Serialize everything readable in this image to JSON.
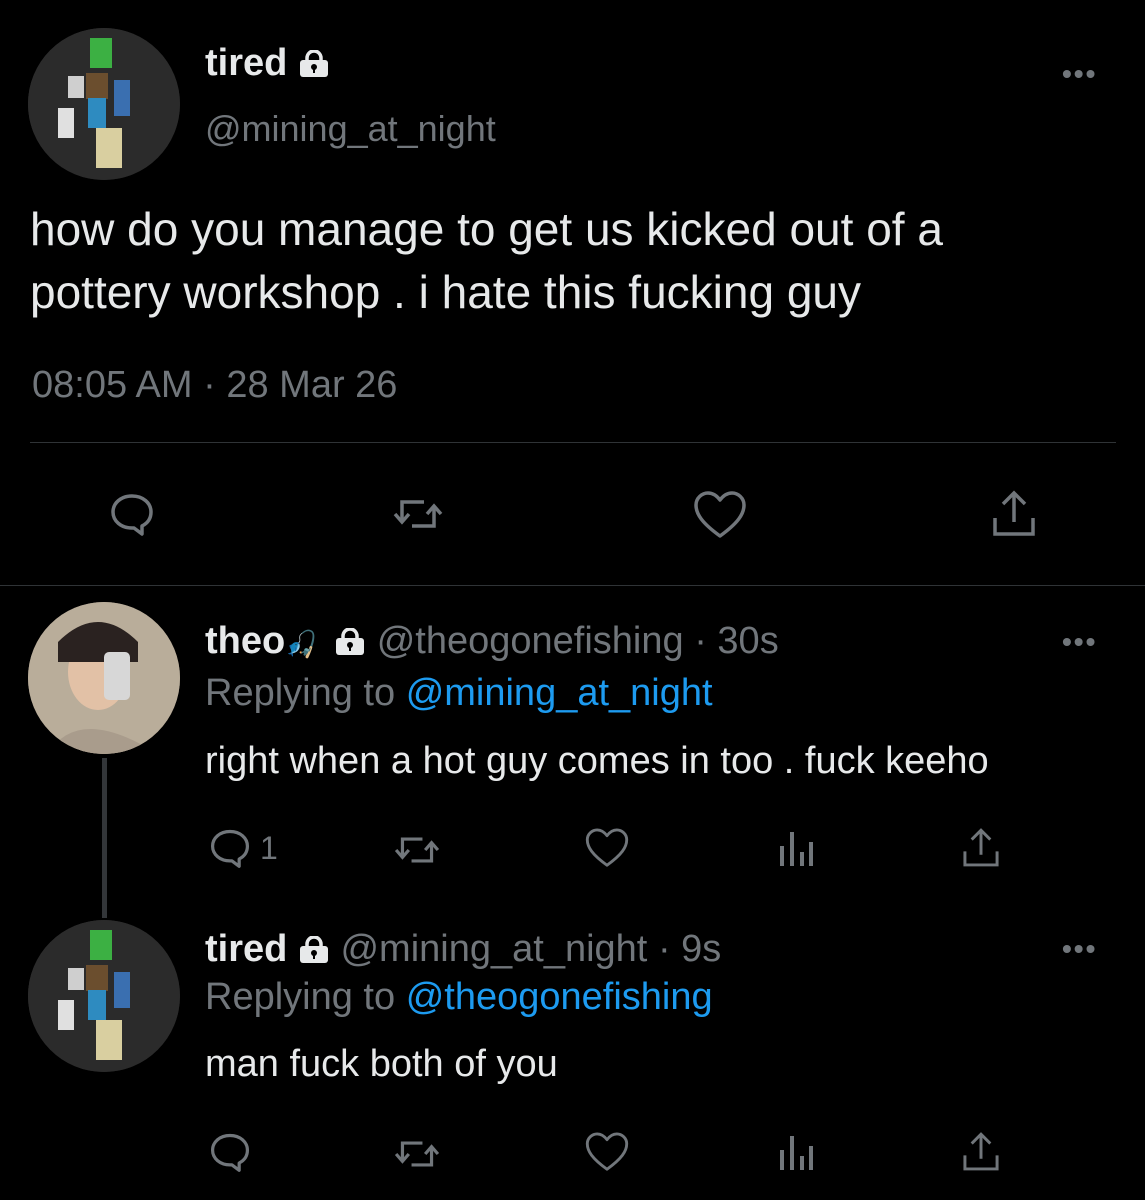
{
  "main_tweet": {
    "display_name": "tired",
    "handle": "@mining_at_night",
    "text_line1": "how do you manage to get us kicked out of a",
    "text_line2": "pottery workshop . i hate this fucking guy",
    "time": "08:05 AM",
    "date": "28 Mar 26",
    "meta_sep": "·",
    "more": "•••"
  },
  "reply1": {
    "display_name": "theo",
    "name_emoji": "🎣",
    "handle": "@theogonefishing",
    "sep": "·",
    "age": "30s",
    "replying_prefix": "Replying to",
    "replying_to": "@mining_at_night",
    "text": "right when a hot guy comes in too . fuck keeho",
    "reply_count": "1",
    "more": "•••"
  },
  "reply2": {
    "display_name": "tired",
    "handle": "@mining_at_night",
    "sep": "·",
    "age": "9s",
    "replying_prefix": "Replying to",
    "replying_to": "@theogonefishing",
    "text": "man fuck both of you",
    "more": "•••"
  },
  "colors": {
    "background": "#000000",
    "text": "#e7e9ea",
    "muted": "#71767b",
    "link": "#1d9bf0",
    "divider": "#2f3336"
  }
}
